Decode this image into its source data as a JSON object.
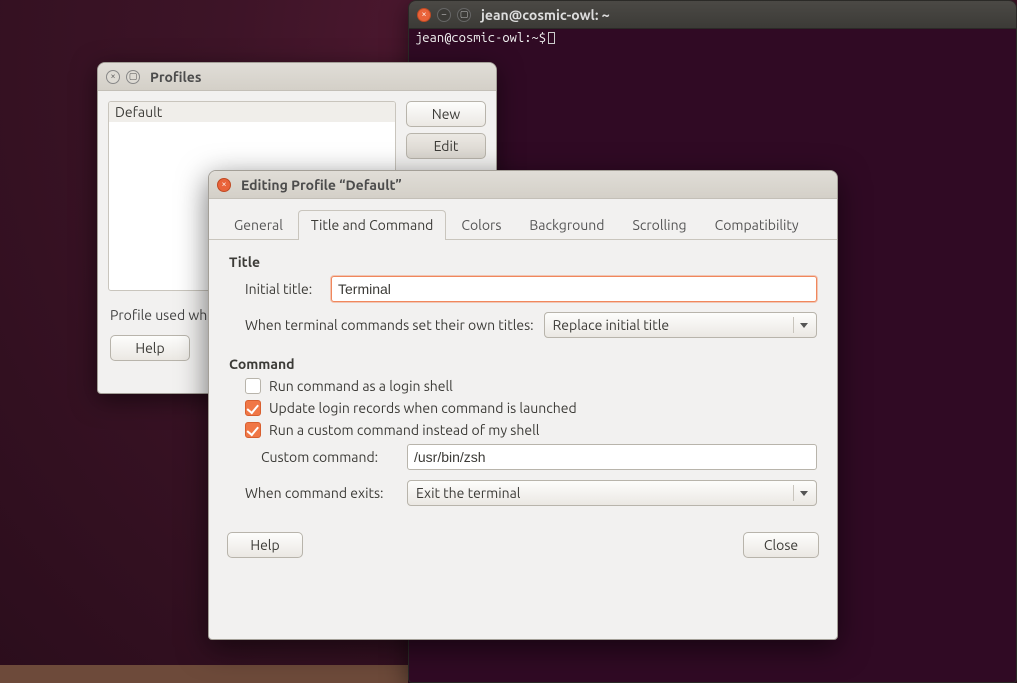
{
  "terminal": {
    "title": "jean@cosmic-owl: ~",
    "prompt": "jean@cosmic-owl:~$"
  },
  "profiles_window": {
    "title": "Profiles",
    "list": [
      "Default"
    ],
    "buttons": {
      "new": "New",
      "edit": "Edit"
    },
    "desc": "Profile used wh",
    "help": "Help"
  },
  "dialog": {
    "title": "Editing Profile “Default”",
    "tabs": {
      "general": "General",
      "title_command": "Title and Command",
      "colors": "Colors",
      "background": "Background",
      "scrolling": "Scrolling",
      "compatibility": "Compatibility"
    },
    "title_section": {
      "head": "Title",
      "initial_title_label": "Initial title:",
      "initial_title_value": "Terminal",
      "when_label": "When terminal commands set their own titles:",
      "when_value": "Replace initial title"
    },
    "command_section": {
      "head": "Command",
      "cb_login": "Run command as a login shell",
      "cb_update": "Update login records when command is launched",
      "cb_custom": "Run a custom command instead of my shell",
      "custom_label": "Custom command:",
      "custom_value": "/usr/bin/zsh",
      "exit_label": "When command exits:",
      "exit_value": "Exit the terminal"
    },
    "footer": {
      "help": "Help",
      "close": "Close"
    }
  }
}
